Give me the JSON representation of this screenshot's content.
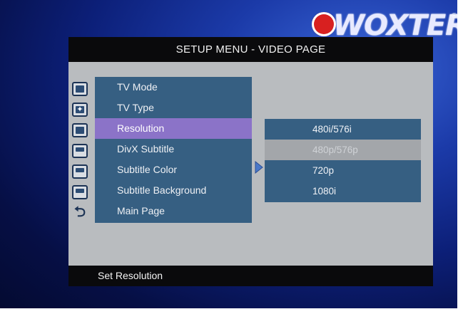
{
  "brand": {
    "logo_text": "WOXTER",
    "logo_mark": "®"
  },
  "menu": {
    "title": "SETUP MENU - VIDEO PAGE",
    "items": [
      {
        "label": "TV Mode",
        "icon": "monitor-icon"
      },
      {
        "label": "TV Type",
        "icon": "tv-type-icon"
      },
      {
        "label": "Resolution",
        "icon": "screen-icon",
        "selected": true
      },
      {
        "label": "DivX Subtitle",
        "icon": "subtitle-icon"
      },
      {
        "label": "Subtitle Color",
        "icon": "subtitle-color-icon"
      },
      {
        "label": "Subtitle Background",
        "icon": "subtitle-background-icon"
      },
      {
        "label": "Main Page",
        "icon": "back-arrow-icon"
      }
    ],
    "options": [
      "480i/576i",
      "480p/576p",
      "720p",
      "1080i"
    ],
    "highlighted_option": "480p/576p",
    "footer": "Set Resolution"
  },
  "colors": {
    "list_bg": "#365f82",
    "selected_bg": "#8b73c8",
    "highlight_bg": "#a3a6aa",
    "panel_bg": "#b9bcbf",
    "header_bg": "#0a0a0c"
  }
}
